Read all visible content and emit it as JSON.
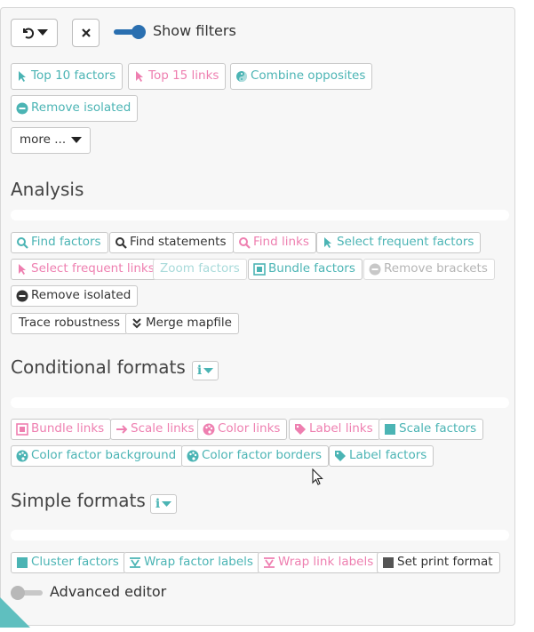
{
  "toolbar": {
    "undo_icon": "undo-icon",
    "close_icon": "close-icon",
    "show_filters_label": "Show filters",
    "show_filters_on": true
  },
  "filters": {
    "top10": "Top 10 factors",
    "top15": "Top 15 links",
    "combine": "Combine opposites",
    "remove_isolated": "Remove isolated",
    "more": "more ..."
  },
  "analysis": {
    "title": "Analysis",
    "find_factors": "Find factors",
    "find_statements": "Find statements",
    "find_links": "Find links",
    "select_frequent_factors": "Select frequent factors",
    "select_frequent_links": "Select frequent links",
    "zoom_factors": "Zoom factors",
    "bundle_factors": "Bundle factors",
    "remove_brackets": "Remove brackets",
    "remove_isolated": "Remove isolated",
    "trace_robustness": "Trace robustness",
    "merge_mapfile": "Merge mapfile"
  },
  "conditional": {
    "title": "Conditional formats",
    "bundle_links": "Bundle links",
    "scale_links": "Scale links",
    "color_links": "Color links",
    "label_links": "Label links",
    "scale_factors": "Scale factors",
    "color_factor_background": "Color factor background",
    "color_factor_borders": "Color factor borders",
    "label_factors": "Label factors"
  },
  "simple": {
    "title": "Simple formats",
    "cluster_factors": "Cluster factors",
    "wrap_factor_labels": "Wrap factor labels",
    "wrap_link_labels": "Wrap link labels",
    "set_print_format": "Set print format"
  },
  "advanced": {
    "label": "Advanced editor",
    "on": false
  },
  "colors": {
    "teal": "#4bb4b4",
    "pink": "#ee7fb0",
    "toggle_on": "#2a6fb0",
    "toggle_off": "#b8b8b8"
  }
}
